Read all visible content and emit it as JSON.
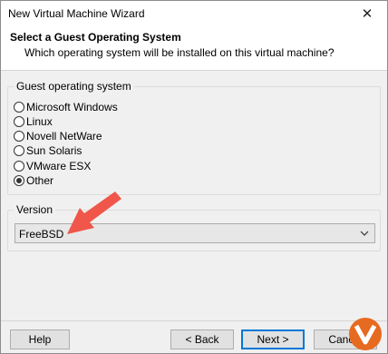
{
  "window": {
    "title": "New Virtual Machine Wizard"
  },
  "header": {
    "title": "Select a Guest Operating System",
    "subtitle": "Which operating system will be installed on this virtual machine?"
  },
  "guest_os": {
    "label": "Guest operating system",
    "options": [
      {
        "label": "Microsoft Windows",
        "selected": false
      },
      {
        "label": "Linux",
        "selected": false
      },
      {
        "label": "Novell NetWare",
        "selected": false
      },
      {
        "label": "Sun Solaris",
        "selected": false
      },
      {
        "label": "VMware ESX",
        "selected": false
      },
      {
        "label": "Other",
        "selected": true
      }
    ]
  },
  "version": {
    "label": "Version",
    "value": "FreeBSD"
  },
  "buttons": {
    "help": "Help",
    "back": "< Back",
    "next": "Next >",
    "cancel": "Cancel"
  },
  "colors": {
    "annotation_arrow": "#f0564a",
    "focus_border": "#0078d7"
  }
}
